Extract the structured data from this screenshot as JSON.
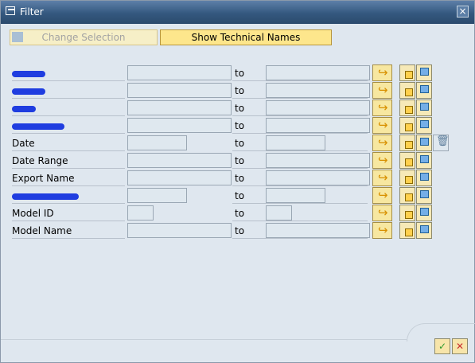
{
  "window": {
    "title": "Filter",
    "close_icon": "close-icon"
  },
  "toolbar": {
    "change_selection": "Change Selection",
    "show_technical_names": "Show Technical Names"
  },
  "fields": [
    {
      "label": "",
      "redacted": true
    },
    {
      "label": "",
      "redacted": true
    },
    {
      "label": "",
      "redacted": true
    },
    {
      "label": "",
      "redacted": true
    },
    {
      "label": "Date",
      "redacted": false
    },
    {
      "label": "Date Range",
      "redacted": false
    },
    {
      "label": "Export Name",
      "redacted": false
    },
    {
      "label": "",
      "redacted": true
    },
    {
      "label": "Model ID",
      "redacted": false
    },
    {
      "label": "Model Name",
      "redacted": false
    }
  ],
  "to_label": "to",
  "footer": {
    "ok_icon": "check-icon",
    "cancel_icon": "cancel-icon"
  }
}
